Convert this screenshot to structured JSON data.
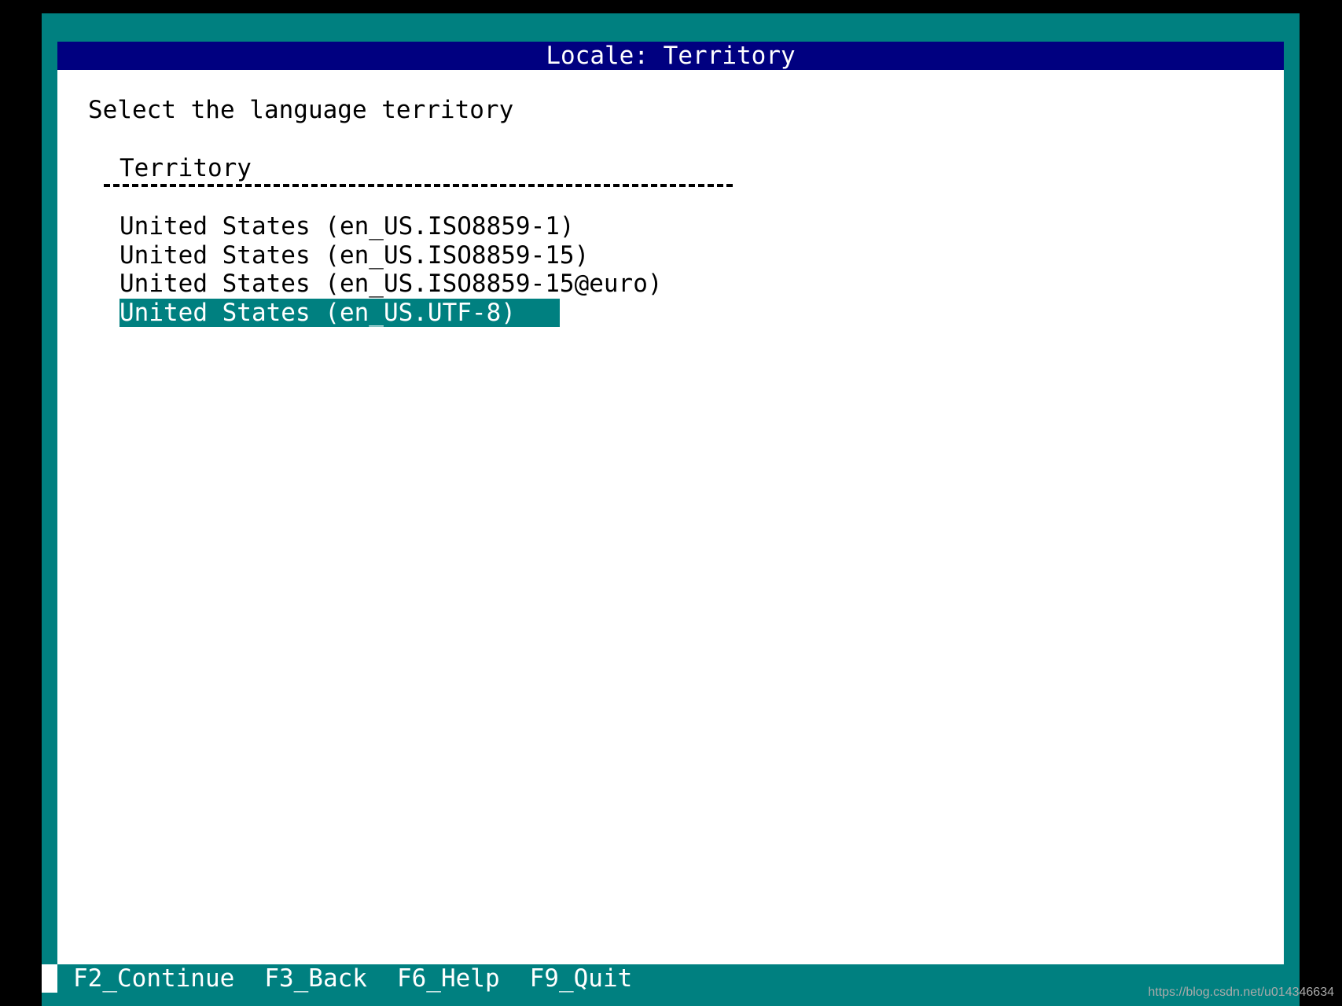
{
  "window": {
    "title": "Locale: Territory"
  },
  "dialog": {
    "prompt": "Select the language territory",
    "column_header": "Territory"
  },
  "territories": [
    {
      "label": "United States (en_US.ISO8859-1)",
      "selected": false
    },
    {
      "label": "United States (en_US.ISO8859-15)",
      "selected": false
    },
    {
      "label": "United States (en_US.ISO8859-15@euro)",
      "selected": false
    },
    {
      "label": "United States (en_US.UTF-8)",
      "selected": true
    }
  ],
  "function_keys": [
    {
      "label": "F2_Continue"
    },
    {
      "label": "F3_Back"
    },
    {
      "label": "F6_Help"
    },
    {
      "label": "F9_Quit"
    }
  ],
  "watermark": "https://blog.csdn.net/u014346634",
  "colors": {
    "background": "#000000",
    "frame": "#008080",
    "title_bar": "#000080",
    "panel": "#ffffff",
    "selection": "#008080"
  }
}
